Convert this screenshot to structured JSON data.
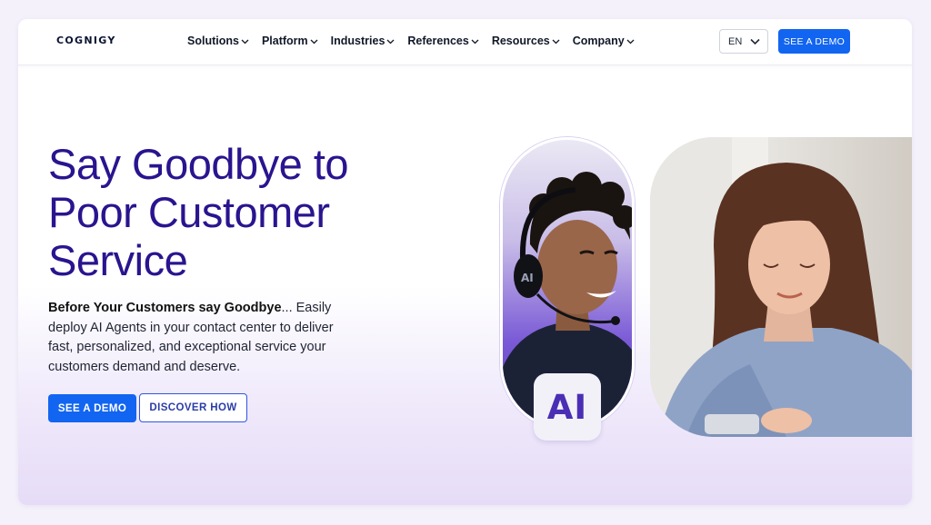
{
  "brand": {
    "logo_text": "COGNIGY"
  },
  "nav": {
    "items": [
      {
        "label": "Solutions"
      },
      {
        "label": "Platform"
      },
      {
        "label": "Industries"
      },
      {
        "label": "References"
      },
      {
        "label": "Resources"
      },
      {
        "label": "Company"
      }
    ],
    "language": "EN",
    "cta_label": "SEE A DEMO"
  },
  "hero": {
    "title": "Say Goodbye to Poor Customer Service",
    "desc_bold": "Before Your Customers say Goodbye",
    "desc_rest": "... Easily deploy AI Agents in your contact center to deliver fast, personalized, and exceptional service your customers demand and deserve.",
    "primary_label": "SEE A DEMO",
    "secondary_label": "DISCOVER HOW",
    "ai_badge": "AI"
  },
  "colors": {
    "primary": "#1265f1",
    "title": "#2a148f",
    "accent": "#5a39c4"
  },
  "icons": {
    "nav_chevron": "chevron-down-icon",
    "headset": "headset-icon"
  }
}
